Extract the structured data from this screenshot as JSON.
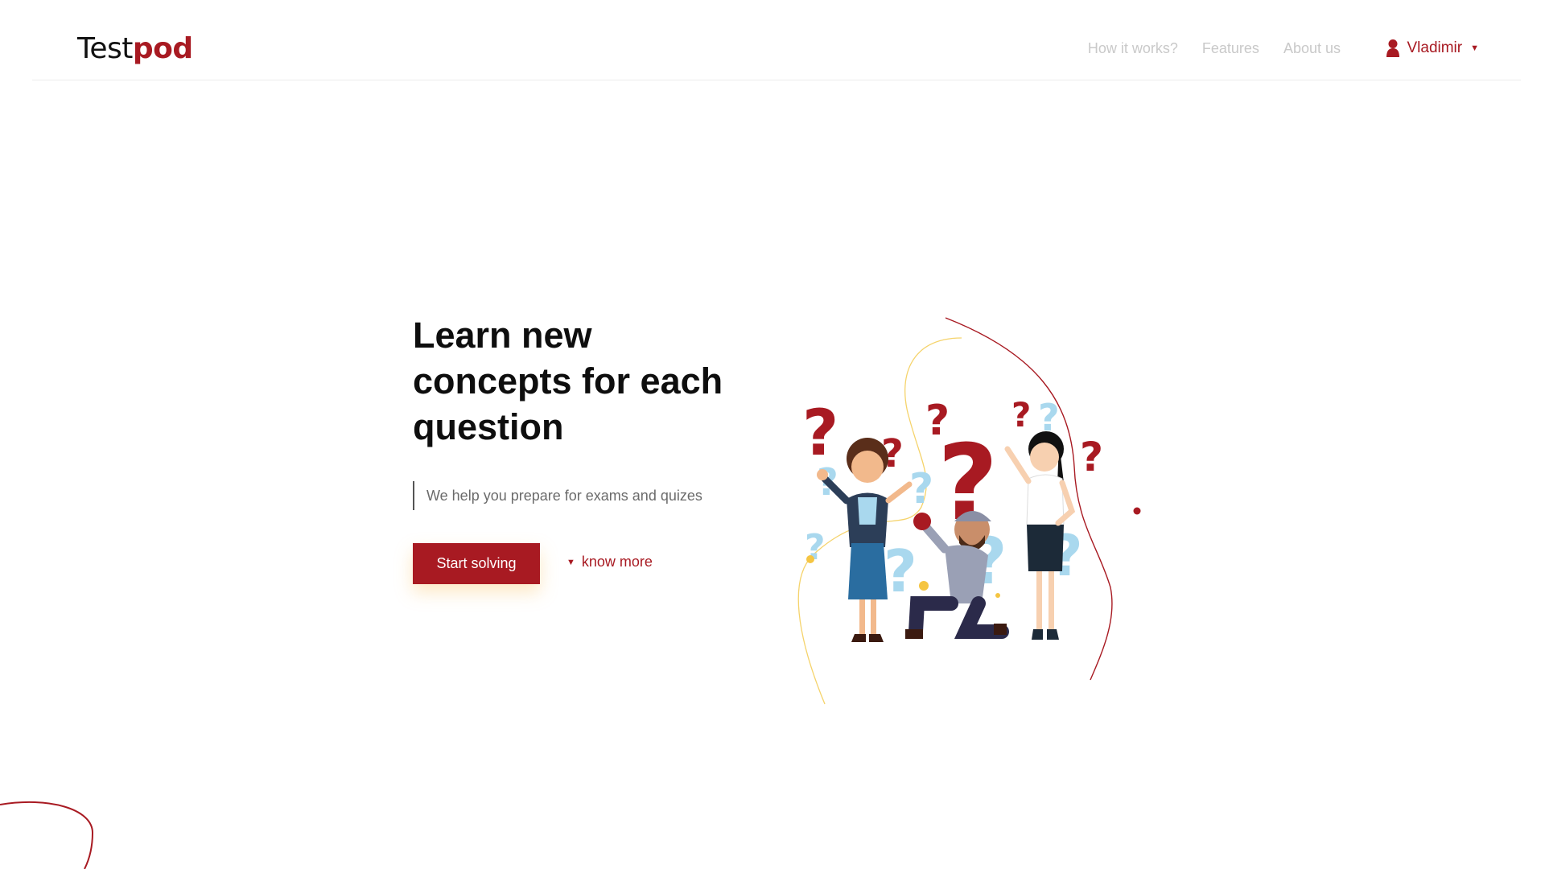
{
  "header": {
    "logo": {
      "part1": "Test",
      "part2": "pod"
    },
    "nav": [
      {
        "label": "How it works?"
      },
      {
        "label": "Features"
      },
      {
        "label": "About us"
      }
    ],
    "user": {
      "name": "Vladimir",
      "icon": "user-icon"
    }
  },
  "hero": {
    "title": "Learn new concepts for each question",
    "subtitle": "We help you prepare for exams and quizes",
    "cta_label": "Start solving",
    "more_label": "know more"
  },
  "colors": {
    "accent": "#a81a22",
    "nav_text": "#c9c9c9",
    "light_blue": "#a9d8ee",
    "yellow": "#f5c542"
  }
}
